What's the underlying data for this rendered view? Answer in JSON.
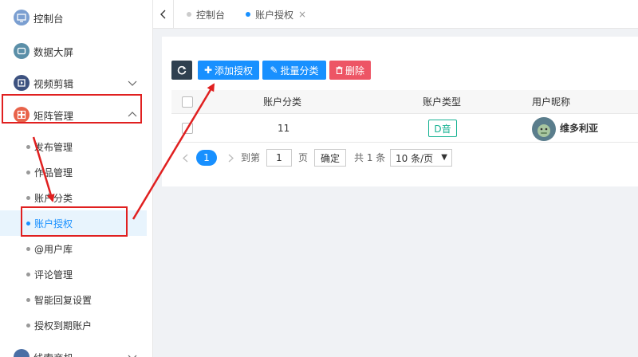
{
  "sidebar": {
    "items": [
      {
        "label": "控制台",
        "icon": "monitor-icon",
        "color": "#6c8ebf"
      },
      {
        "label": "数据大屏",
        "icon": "screen-icon",
        "color": "#5b8fa8"
      },
      {
        "label": "视频剪辑",
        "icon": "video-edit-icon",
        "color": "#4a5f8a"
      },
      {
        "label": "矩阵管理",
        "icon": "matrix-icon",
        "color": "#e8634a"
      }
    ],
    "sub_items": [
      {
        "label": "发布管理"
      },
      {
        "label": "作品管理"
      },
      {
        "label": "账户分类"
      },
      {
        "label": "账户授权"
      },
      {
        "label": "@用户库"
      },
      {
        "label": "评论管理"
      },
      {
        "label": "智能回复设置"
      },
      {
        "label": "授权到期账户"
      }
    ],
    "last_item": {
      "label": "线索商机"
    }
  },
  "tabs": [
    {
      "label": "控制台"
    },
    {
      "label": "账户授权",
      "close": "×"
    }
  ],
  "toolbar": {
    "add_label": "添加授权",
    "batch_label": "批量分类",
    "delete_label": "删除"
  },
  "table": {
    "headers": [
      "账户分类",
      "账户类型",
      "用户昵称"
    ],
    "rows": [
      {
        "category": "11",
        "type": "D音",
        "nickname": "维多利亚"
      }
    ]
  },
  "pager": {
    "current_page": "1",
    "goto_label": "到第",
    "page_input": "1",
    "page_unit": "页",
    "confirm_label": "确定",
    "total_label": "共 1 条",
    "page_size": "10 条/页"
  },
  "colors": {
    "primary": "#1890ff",
    "danger": "#ed5565",
    "annotation": "#e02020",
    "success": "#1ab394"
  }
}
